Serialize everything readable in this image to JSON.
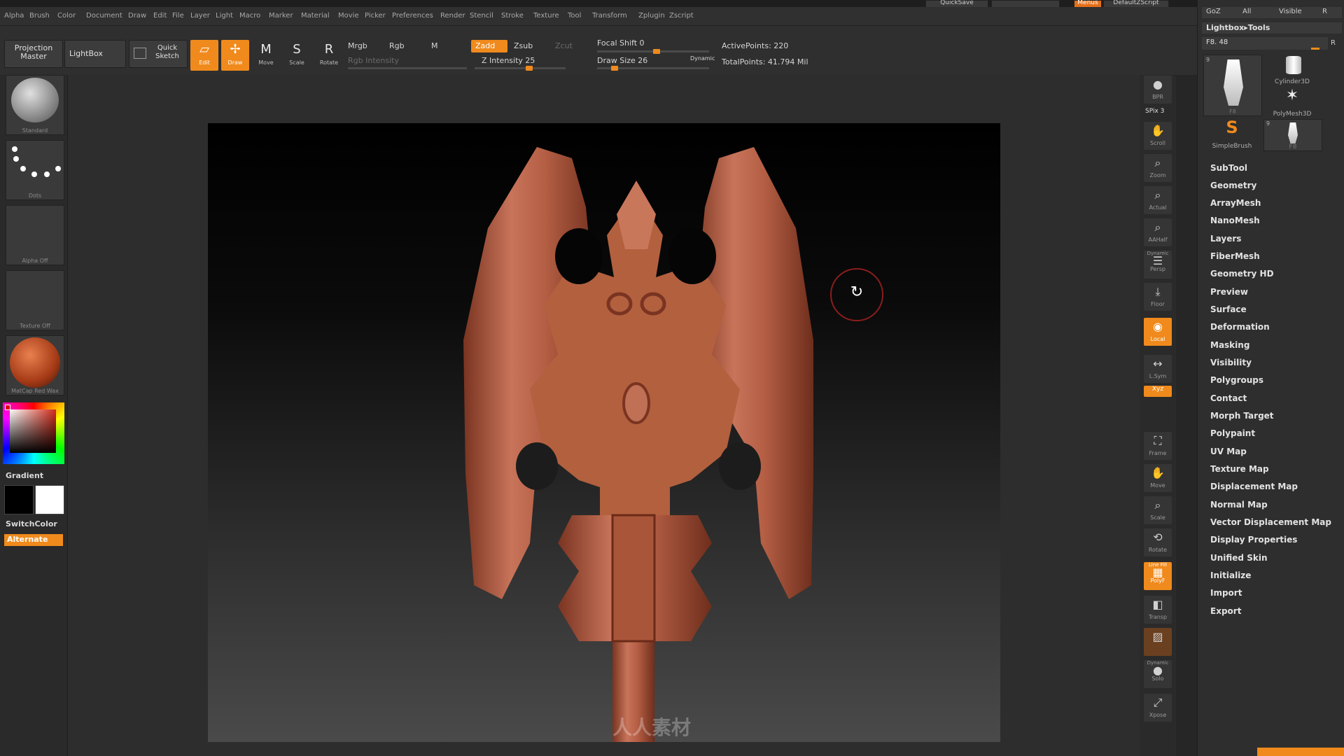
{
  "top": {
    "quicksave": "QuickSave",
    "menus": "Menus",
    "default_zscript": "DefaultZScript",
    "goz": "GoZ",
    "all": "All",
    "visible": "Visible",
    "r": "R"
  },
  "menubar": [
    "Alpha",
    "Brush",
    "Color",
    "Document",
    "Draw",
    "Edit",
    "File",
    "Layer",
    "Light",
    "Macro",
    "Marker",
    "Material",
    "Movie",
    "Picker",
    "Preferences",
    "Render",
    "Stencil",
    "Stroke",
    "Texture",
    "Tool",
    "Transform",
    "Zplugin",
    "Zscript"
  ],
  "shelf": {
    "projection_master": "Projection Master",
    "lightbox": "LightBox",
    "quick_sketch": "Quick Sketch",
    "edit": "Edit",
    "draw": "Draw",
    "move": "Move",
    "scale": "Scale",
    "rotate": "Rotate",
    "mrgb": "Mrgb",
    "rgb": "Rgb",
    "m": "M",
    "rgb_intensity": "Rgb Intensity",
    "zadd": "Zadd",
    "zsub": "Zsub",
    "zcut": "Zcut",
    "z_intensity": "Z Intensity 25",
    "focal_shift": "Focal Shift 0",
    "draw_size": "Draw Size 26",
    "dynamic": "Dynamic",
    "active_points": "ActivePoints: 220",
    "total_points": "TotalPoints: 41.794 Mil"
  },
  "left": {
    "brush": "Standard",
    "stroke": "Dots",
    "alpha": "Alpha Off",
    "texture": "Texture Off",
    "material": "MatCap Red Wax",
    "gradient": "Gradient",
    "switchcolor": "SwitchColor",
    "alternate": "Alternate"
  },
  "righttools": {
    "bpr": "BPR",
    "spix": "SPix 3",
    "scroll": "Scroll",
    "zoom": "Zoom",
    "actual": "Actual",
    "aahalf": "AAHalf",
    "dynamic": "Dynamic",
    "persp": "Persp",
    "floor": "Floor",
    "local": "Local",
    "lsym": "L.Sym",
    "xyz": "Xyz",
    "frame": "Frame",
    "move": "Move",
    "scale": "Scale",
    "rotate": "Rotate",
    "polyf": "PolyF",
    "line_fill": "Line Fill",
    "transp": "Transp",
    "dynamic2": "Dynamic",
    "solo": "Solo",
    "xpose": "Xpose"
  },
  "palette": {
    "header": "Lightbox▸Tools",
    "tool_name": "F8. 48",
    "r": "R",
    "tiles": [
      {
        "label": "F8",
        "count": "9"
      },
      {
        "label": "Cylinder3D"
      },
      {
        "label": "PolyMesh3D"
      },
      {
        "label": "SimpleBrush"
      },
      {
        "label": "F8",
        "count": "9"
      }
    ],
    "items": [
      "SubTool",
      "Geometry",
      "ArrayMesh",
      "NanoMesh",
      "Layers",
      "FiberMesh",
      "Geometry HD",
      "Preview",
      "Surface",
      "Deformation",
      "Masking",
      "Visibility",
      "Polygroups",
      "Contact",
      "Morph Target",
      "Polypaint",
      "UV Map",
      "Texture Map",
      "Displacement Map",
      "Normal Map",
      "Vector Displacement Map",
      "Display Properties",
      "Unified Skin",
      "Initialize",
      "Import",
      "Export"
    ]
  },
  "watermark": "人人素材",
  "colors": {
    "accent": "#f08a1c",
    "model": "#b8644a"
  }
}
